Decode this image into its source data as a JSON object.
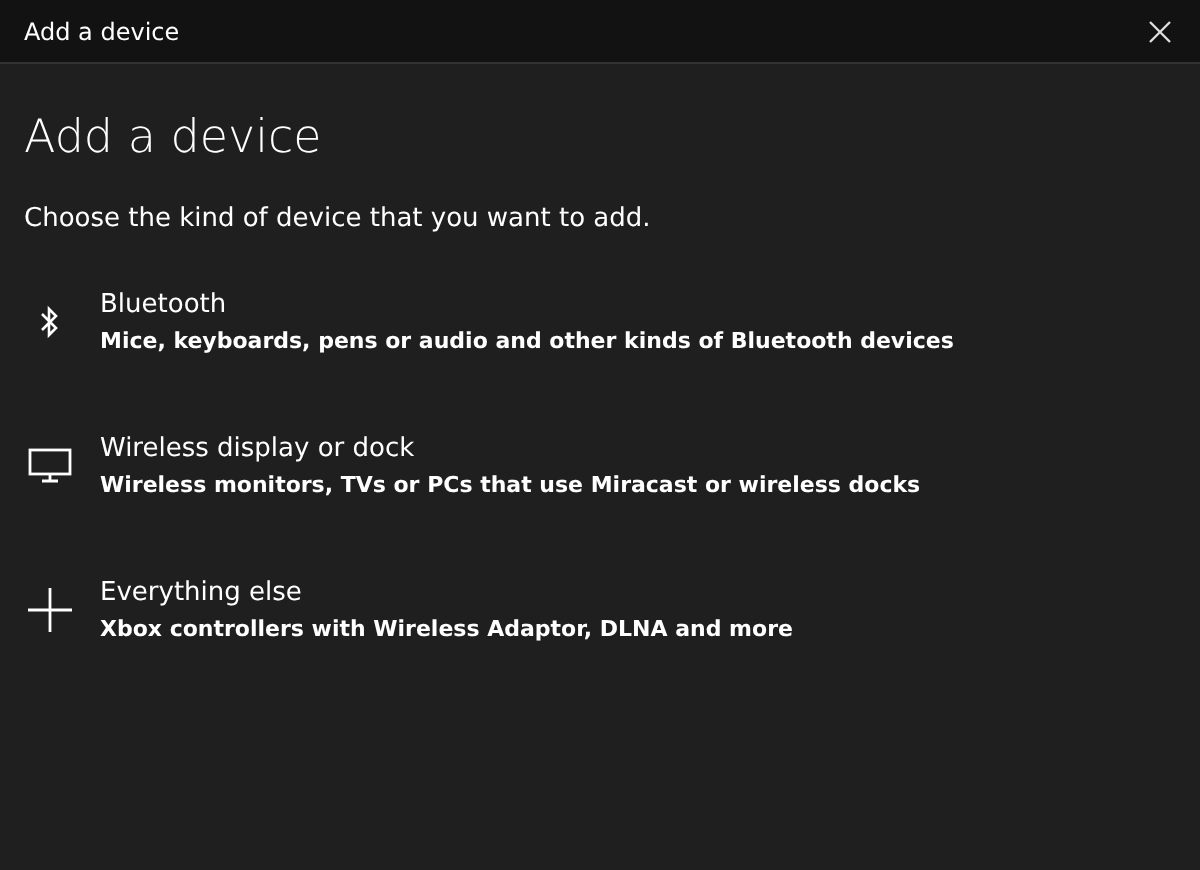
{
  "window": {
    "title": "Add a device"
  },
  "heading": "Add a device",
  "subtitle": "Choose the kind of device that you want to add.",
  "options": [
    {
      "kind": "bluetooth",
      "title": "Bluetooth",
      "description": "Mice, keyboards, pens or audio and other kinds of Bluetooth devices"
    },
    {
      "kind": "display",
      "title": "Wireless display or dock",
      "description": "Wireless monitors, TVs or PCs that use Miracast or wireless docks"
    },
    {
      "kind": "other",
      "title": "Everything else",
      "description": "Xbox controllers with Wireless Adaptor, DLNA and more"
    }
  ]
}
